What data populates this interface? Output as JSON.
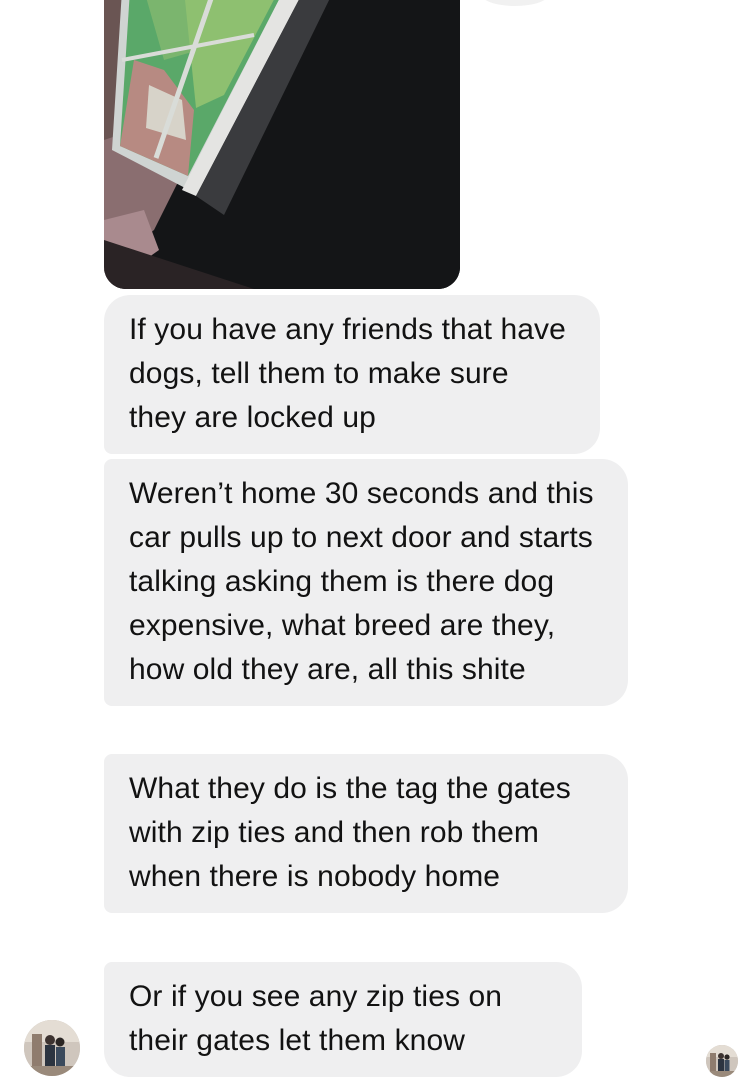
{
  "conversation": {
    "messages": [
      {
        "text": "If you have any friends that have dogs, tell them to make sure they are locked up"
      },
      {
        "text": "Weren’t home 30 seconds and this car pulls up to next door and starts talking asking them is there dog expensive, what breed are they, how old they are, all this shite"
      },
      {
        "text": "What they do is the tag the gates with zip ties and then rob them when there is nobody home"
      },
      {
        "text": "Or if you see any zip ties on their gates let them know"
      }
    ],
    "photo": {
      "icon": "photo-attachment"
    },
    "sender_avatar": {
      "icon": "profile-photo"
    },
    "read_receipt": {
      "icon": "seen-avatar"
    }
  },
  "colors": {
    "bubble_bg": "#efeff0",
    "text": "#121212",
    "background": "#ffffff"
  }
}
